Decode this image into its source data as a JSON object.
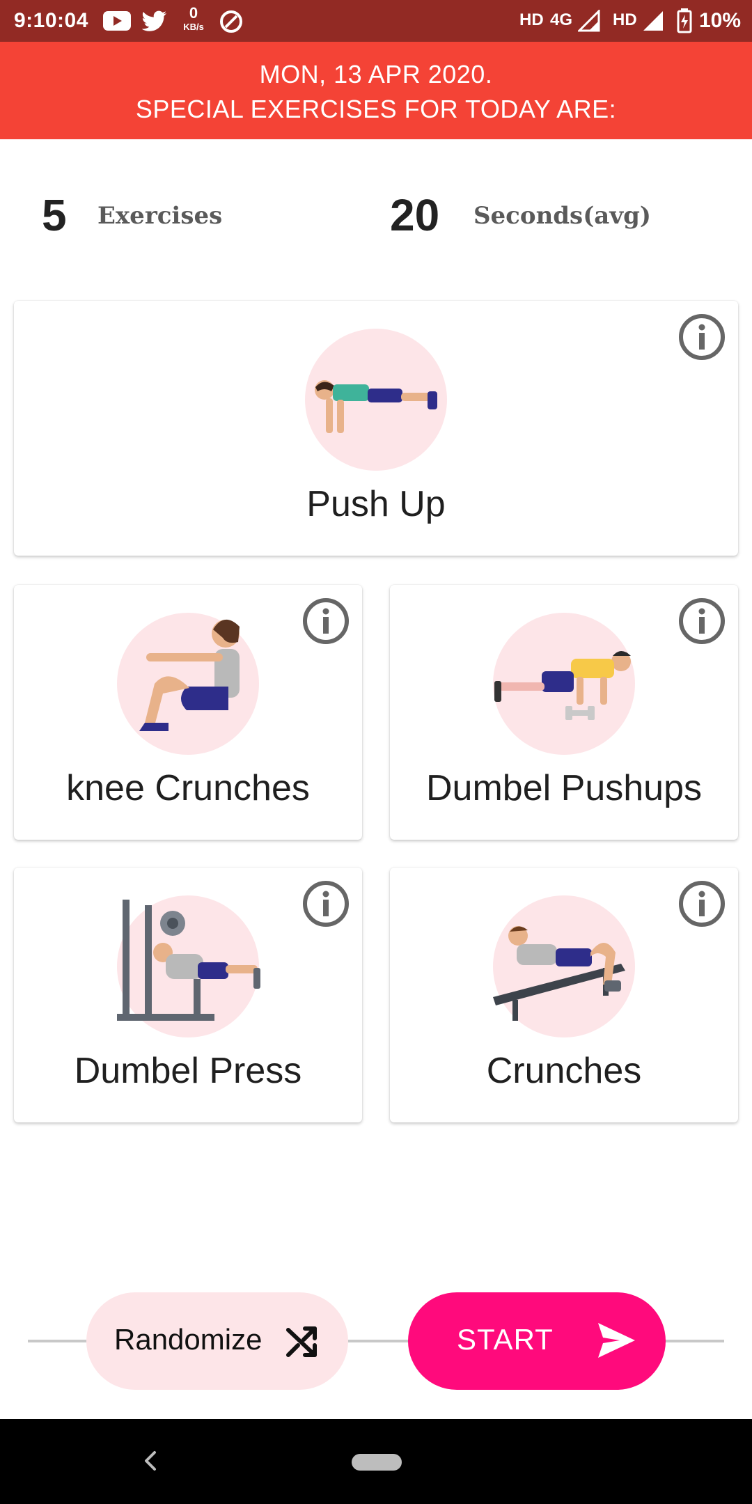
{
  "status_bar": {
    "time": "9:10:04",
    "kbs_value": "0",
    "kbs_unit": "KB/s",
    "network_1": "HD",
    "network_2": "4G",
    "network_3": "HD",
    "battery": "10%",
    "icons": [
      "youtube-icon",
      "twitter-icon",
      "data-saver-icon",
      "signal-icon",
      "battery-charging-icon"
    ]
  },
  "banner": {
    "date_line": "MON, 13 APR 2020.",
    "subtitle": "SPECIAL EXERCISES FOR TODAY ARE:"
  },
  "stats": {
    "exercises_count": "5",
    "exercises_label": "Exercises",
    "seconds_count": "20",
    "seconds_label": "Seconds(avg)"
  },
  "exercises": [
    {
      "name": "Push Up",
      "icon": "push-up-illustration"
    },
    {
      "name": "knee Crunches",
      "icon": "knee-crunches-illustration"
    },
    {
      "name": "Dumbel Pushups",
      "icon": "dumbbell-pushups-illustration"
    },
    {
      "name": "Dumbel Press",
      "icon": "dumbbell-press-illustration"
    },
    {
      "name": "Crunches",
      "icon": "crunches-illustration"
    }
  ],
  "actions": {
    "randomize_label": "Randomize",
    "start_label": "START"
  },
  "colors": {
    "status_bar": "#922a24",
    "banner": "#f44336",
    "accent": "#ff0a7c",
    "soft_pink": "#fde5e8"
  }
}
